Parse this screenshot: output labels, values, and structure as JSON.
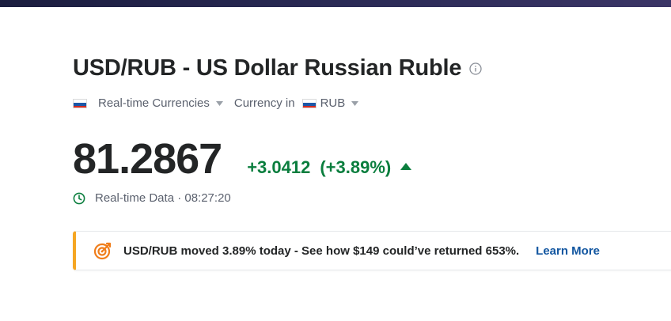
{
  "header": {
    "title": "USD/RUB - US Dollar Russian Ruble",
    "info_icon": "info-icon"
  },
  "meta": {
    "market_type": "Real-time Currencies",
    "currency_label": "Currency in",
    "currency_value": "RUB"
  },
  "quote": {
    "price": "81.2867",
    "change": "+3.0412",
    "change_percent": "(+3.89%)",
    "direction": "up",
    "change_color": "#0b7e3e"
  },
  "status": {
    "data_label": "Real-time Data · 08:27:20"
  },
  "promo": {
    "text": "USD/RUB moved 3.89% today - See how $149 could’ve returned 653%.",
    "link_label": "Learn More",
    "accent_color": "#f5a623"
  }
}
